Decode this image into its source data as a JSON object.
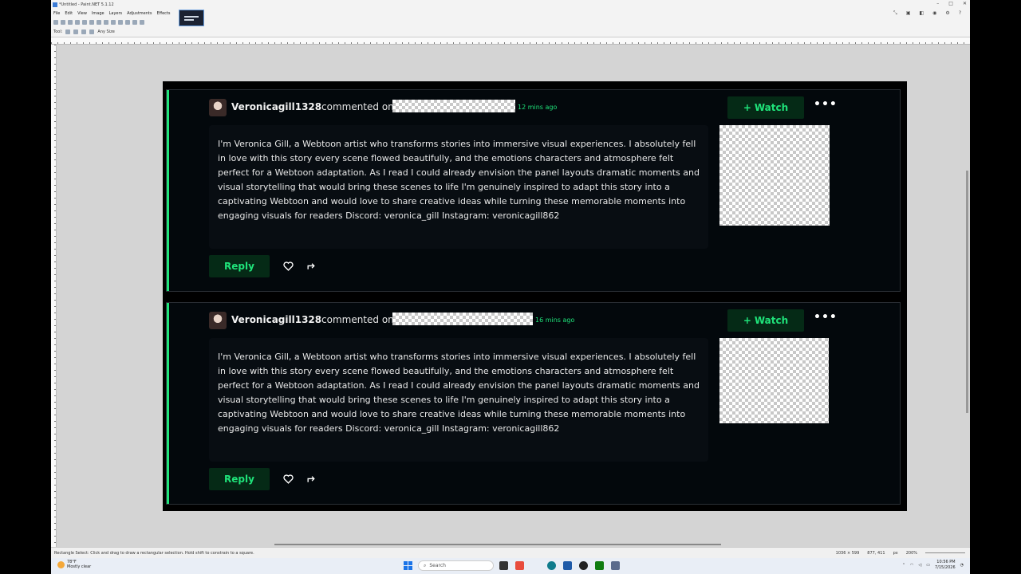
{
  "window": {
    "title": "*Untitled - Paint.NET 5.1.12",
    "controls": [
      "–",
      "□",
      "✕"
    ]
  },
  "menu": [
    "File",
    "Edit",
    "View",
    "Image",
    "Layers",
    "Adjustments",
    "Effects"
  ],
  "toolbar": {
    "tool_label": "Tool:",
    "size_label": "Any Size"
  },
  "comments": [
    {
      "username": "Veronicagill1328",
      "commented_on": "commented on",
      "time": "12 mins ago",
      "watch_label": "Watch",
      "body": "I'm Veronica Gill, a Webtoon artist who transforms stories into immersive visual experiences. I absolutely fell in love with this story every scene flowed beautifully, and the emotions characters and atmosphere felt perfect for a Webtoon adaptation. As I read I could already envision the panel layouts dramatic moments and visual storytelling that would bring these scenes to life I'm genuinely inspired to adapt this story into a captivating Webtoon and would love to share creative ideas while turning these memorable moments into engaging visuals for readers Discord: veronica_gill Instagram: veronicagill862",
      "reply_label": "Reply"
    },
    {
      "username": "Veronicagill1328",
      "commented_on": "commented on",
      "time": "16 mins ago",
      "watch_label": "Watch",
      "body": "I'm Veronica Gill, a Webtoon artist who transforms stories into immersive visual experiences. I absolutely fell in love with this story every scene flowed beautifully, and the emotions characters and atmosphere felt perfect for a Webtoon adaptation. As I read I could already envision the panel layouts dramatic moments and visual storytelling that would bring these scenes to life I'm genuinely inspired to adapt this story into a captivating Webtoon and would love to share creative ideas while turning these memorable moments into engaging visuals for readers Discord: veronica_gill Instagram: veronicagill862",
      "reply_label": "Reply"
    }
  ],
  "status": {
    "hint": "Rectangle Select: Click and drag to draw a rectangular selection. Hold shift to constrain to a square.",
    "selection_size": "1036 × 599",
    "cursor": "877, 411",
    "units": "px",
    "zoom": "200%"
  },
  "taskbar": {
    "weather_temp": "78°F",
    "weather_desc": "Mostly clear",
    "search_placeholder": "Search",
    "time": "10:56 PM",
    "date": "7/15/2026"
  },
  "colors": {
    "accent": "#1fe37a",
    "card_bg": "#03080c",
    "watch_bg": "#052a16"
  }
}
